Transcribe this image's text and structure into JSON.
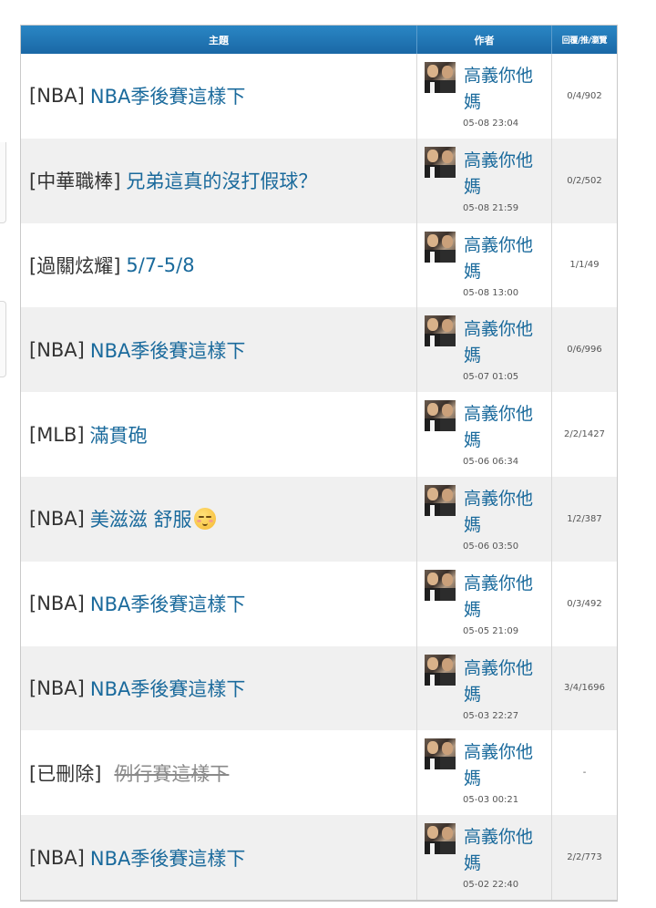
{
  "header": {
    "topic": "主題",
    "author": "作者",
    "stats": "回覆/推/瀏覽"
  },
  "rows": [
    {
      "category": "[NBA]",
      "title": "NBA季後賽這樣下",
      "author": "高義你他媽",
      "time": "05-08 23:04",
      "stats": "0/4/902",
      "deleted": false
    },
    {
      "category": "[中華職棒]",
      "title": "兄弟這真的沒打假球？",
      "author": "高義你他媽",
      "time": "05-08 21:59",
      "stats": "0/2/502",
      "deleted": false
    },
    {
      "category": "[過關炫耀]",
      "title": "5/7-5/8",
      "author": "高義你他媽",
      "time": "05-08 13:00",
      "stats": "1/1/49",
      "deleted": false
    },
    {
      "category": "[NBA]",
      "title": "NBA季後賽這樣下",
      "author": "高義你他媽",
      "time": "05-07 01:05",
      "stats": "0/6/996",
      "deleted": false
    },
    {
      "category": "[MLB]",
      "title": "滿貫砲",
      "author": "高義你他媽",
      "time": "05-06 06:34",
      "stats": "2/2/1427",
      "deleted": false
    },
    {
      "category": "[NBA]",
      "title": "美滋滋 舒服",
      "author": "高義你他媽",
      "time": "05-06 03:50",
      "stats": "1/2/387",
      "deleted": false,
      "emoji": "relieved-face"
    },
    {
      "category": "[NBA]",
      "title": "NBA季後賽這樣下",
      "author": "高義你他媽",
      "time": "05-05 21:09",
      "stats": "0/3/492",
      "deleted": false
    },
    {
      "category": "[NBA]",
      "title": "NBA季後賽這樣下",
      "author": "高義你他媽",
      "time": "05-03 22:27",
      "stats": "3/4/1696",
      "deleted": false
    },
    {
      "category": "[已刪除]",
      "title": "例行賽這樣下",
      "author": "高義你他媽",
      "time": "05-03 00:21",
      "stats": "-",
      "deleted": true
    },
    {
      "category": "[NBA]",
      "title": "NBA季後賽這樣下",
      "author": "高義你他媽",
      "time": "05-02 22:40",
      "stats": "2/2/773",
      "deleted": false
    }
  ],
  "colors": {
    "header_bg": "#1f77b8",
    "link": "#1a6a9c",
    "alt_row": "#f0f0f0"
  }
}
